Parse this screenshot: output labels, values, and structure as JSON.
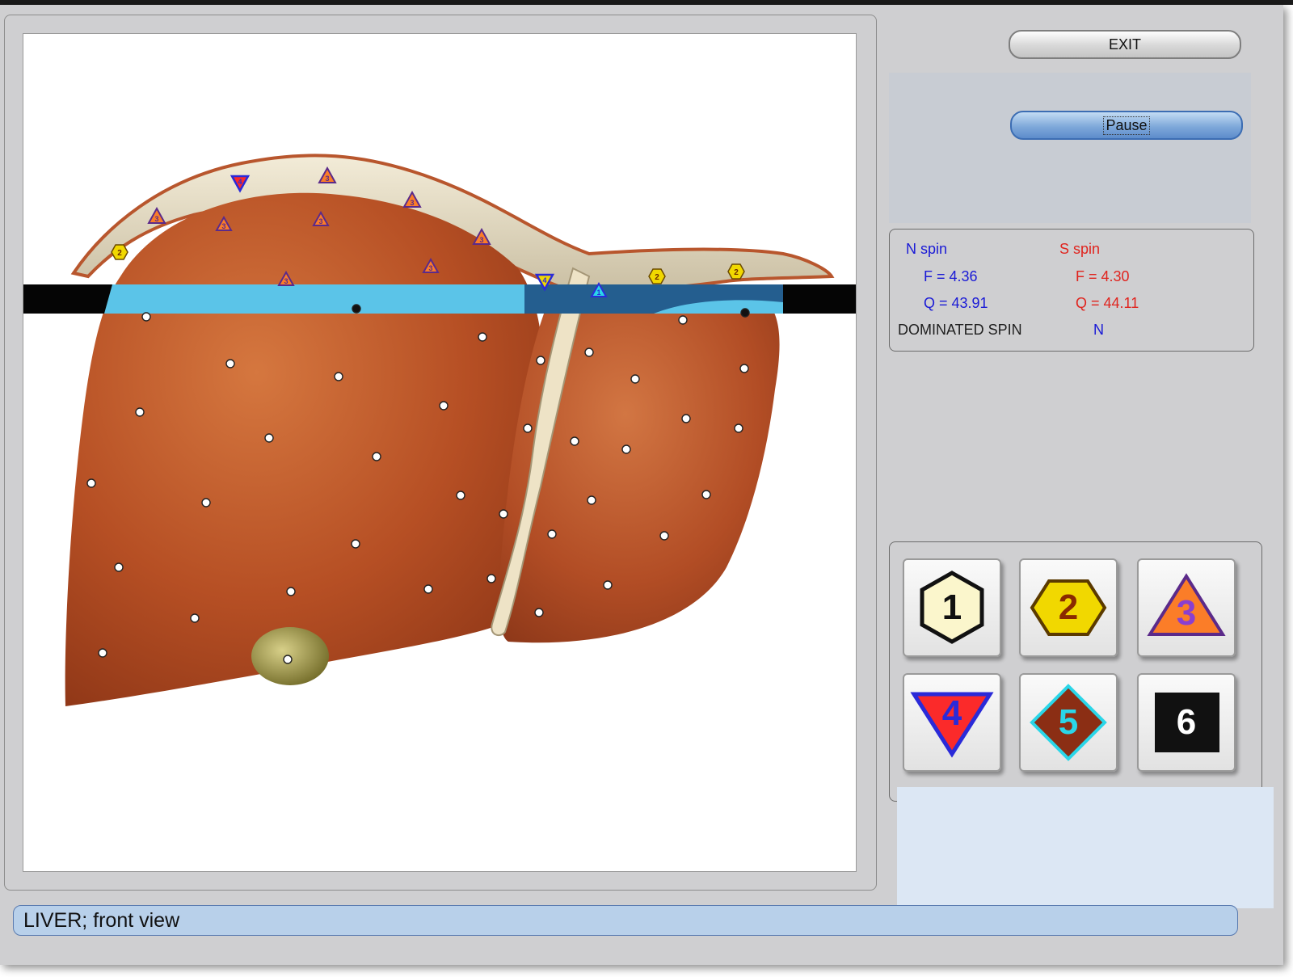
{
  "controls": {
    "exit_label": "EXIT",
    "pause_label": "Pause"
  },
  "spin_info": {
    "n_spin": {
      "title": "N spin",
      "f": "F =  4.36",
      "q": "Q = 43.91"
    },
    "s_spin": {
      "title": "S spin",
      "f": "F =  4.30",
      "q": "Q = 44.11"
    },
    "dominated_label": "DOMINATED SPIN",
    "dominated_value": "N"
  },
  "shape_buttons": [
    {
      "label": "1",
      "shape": "hexagon",
      "fill": "#fbf6cc",
      "text": "#111111"
    },
    {
      "label": "2",
      "shape": "hexagon-wide",
      "fill": "#f1d800",
      "text": "#8a2a00"
    },
    {
      "label": "3",
      "shape": "triangle-up",
      "fill": "#fb7d28",
      "text": "#8a3fd0"
    },
    {
      "label": "4",
      "shape": "triangle-down",
      "fill": "#fb2a2a",
      "text": "#2a2ad8"
    },
    {
      "label": "5",
      "shape": "diamond",
      "fill": "#8b2e14",
      "text": "#2ad6e8"
    },
    {
      "label": "6",
      "shape": "square",
      "fill": "#111111",
      "text": "#ffffff"
    }
  ],
  "markers": {
    "triangle_labels": [
      "3",
      "3",
      "3",
      "3",
      "3",
      "3",
      "3",
      "3",
      "3"
    ],
    "hexagon_labels": [
      "2",
      "2",
      "2"
    ],
    "down_triangle_labels": [
      "4",
      "4"
    ],
    "up_triangle_blue_labels": [
      "1"
    ]
  },
  "status": {
    "text": "LIVER; front  view"
  },
  "colors": {
    "window_bg": "#cfcfd1",
    "liver": "#b64f24",
    "scan_line": "#5bc4e8",
    "status_bar": "#b8d0ea"
  }
}
